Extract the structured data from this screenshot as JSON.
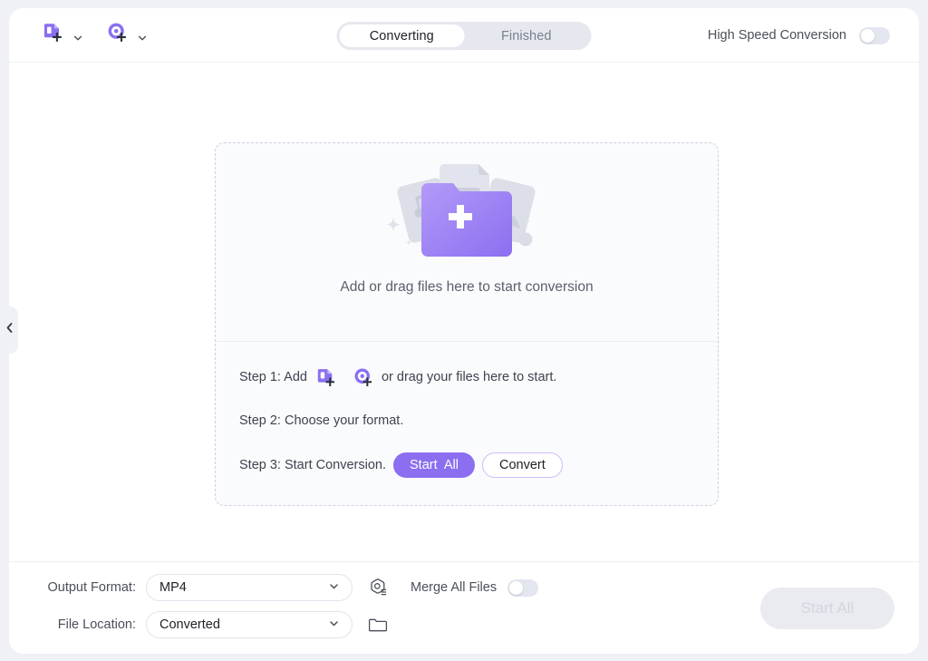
{
  "window": {
    "collapse_handle_icon": "chevron-left-icon"
  },
  "header": {
    "add_file_button": {
      "icon": "add-file-icon",
      "caret_icon": "chevron-down-icon"
    },
    "add_disc_button": {
      "icon": "add-disc-icon",
      "caret_icon": "chevron-down-icon"
    },
    "tabs": [
      {
        "label": "Converting",
        "active": true
      },
      {
        "label": "Finished",
        "active": false
      }
    ],
    "high_speed": {
      "label": "High Speed Conversion",
      "enabled": false
    }
  },
  "dropzone": {
    "caption": "Add or drag files here to start conversion",
    "illustration": {
      "folder_plus_icon": "folder-plus-icon",
      "card_music_icon": "music-note-card-icon",
      "card_video_icon": "video-play-card-icon",
      "card_image_icon": "image-card-icon",
      "sparkle_icon": "sparkle-icon"
    },
    "steps": [
      {
        "prefix": "Step 1: Add",
        "suffix": "or drag your files here to start.",
        "icon_file": "add-file-icon",
        "icon_disc": "add-disc-icon"
      },
      {
        "prefix": "Step 2: Choose your format.",
        "suffix": ""
      },
      {
        "prefix": "Step 3: Start Conversion.",
        "button_primary": "Start  All",
        "button_secondary": "Convert"
      }
    ]
  },
  "footer": {
    "output_format": {
      "label": "Output Format:",
      "value": "MP4",
      "caret_icon": "chevron-down-icon",
      "settings_icon": "settings-hex-icon"
    },
    "file_location": {
      "label": "File Location:",
      "value": "Converted",
      "caret_icon": "chevron-down-icon",
      "folder_icon": "folder-icon"
    },
    "merge_all_files": {
      "label": "Merge All Files",
      "enabled": false
    },
    "start_all_button": {
      "label": "Start All",
      "disabled": true
    }
  },
  "colors": {
    "accent": "#8b6ff0",
    "accent_light": "#a98ef7",
    "page_bg": "#eff1f6",
    "surface": "#ffffff",
    "dropzone_bg": "#fafbfd",
    "border": "#e1e4ec",
    "text": "#3f434e",
    "text_muted": "#7a7f8c"
  }
}
